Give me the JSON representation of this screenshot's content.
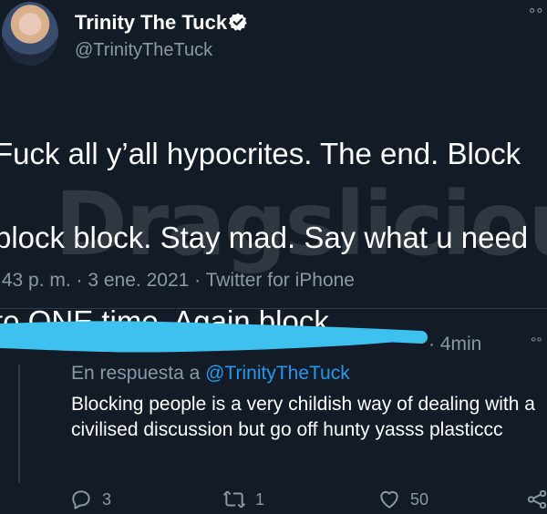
{
  "tweet": {
    "author_name": "Trinity The Tuck",
    "handle": "@TrinityTheTuck",
    "text_lines": [
      "Fuck all y’all hypocrites. The end. Block",
      "block block. Stay mad. Say what u need",
      "to ONE time. Again block."
    ],
    "meta": ":43 p. m. · 3 ene. 2021 · Twitter for iPhone"
  },
  "watermark": "Dragslicious",
  "reply": {
    "time": "· 4min",
    "reply_to_prefix": "En respuesta a",
    "reply_to_handle": "@TrinityTheTuck",
    "text": "Blocking people is a very childish way of dealing with a civilised discussion but go off hunty yasss plasticcc",
    "counts": {
      "replies": "3",
      "retweets": "1",
      "likes": "50"
    }
  },
  "colors": {
    "background": "#121b26",
    "secondary_text": "#8a99a8",
    "link": "#1d9bf0",
    "redaction": "#3fc1f0"
  },
  "icons": [
    "verified-badge-icon",
    "more-icon",
    "reply-icon",
    "retweet-icon",
    "like-icon",
    "share-icon"
  ]
}
